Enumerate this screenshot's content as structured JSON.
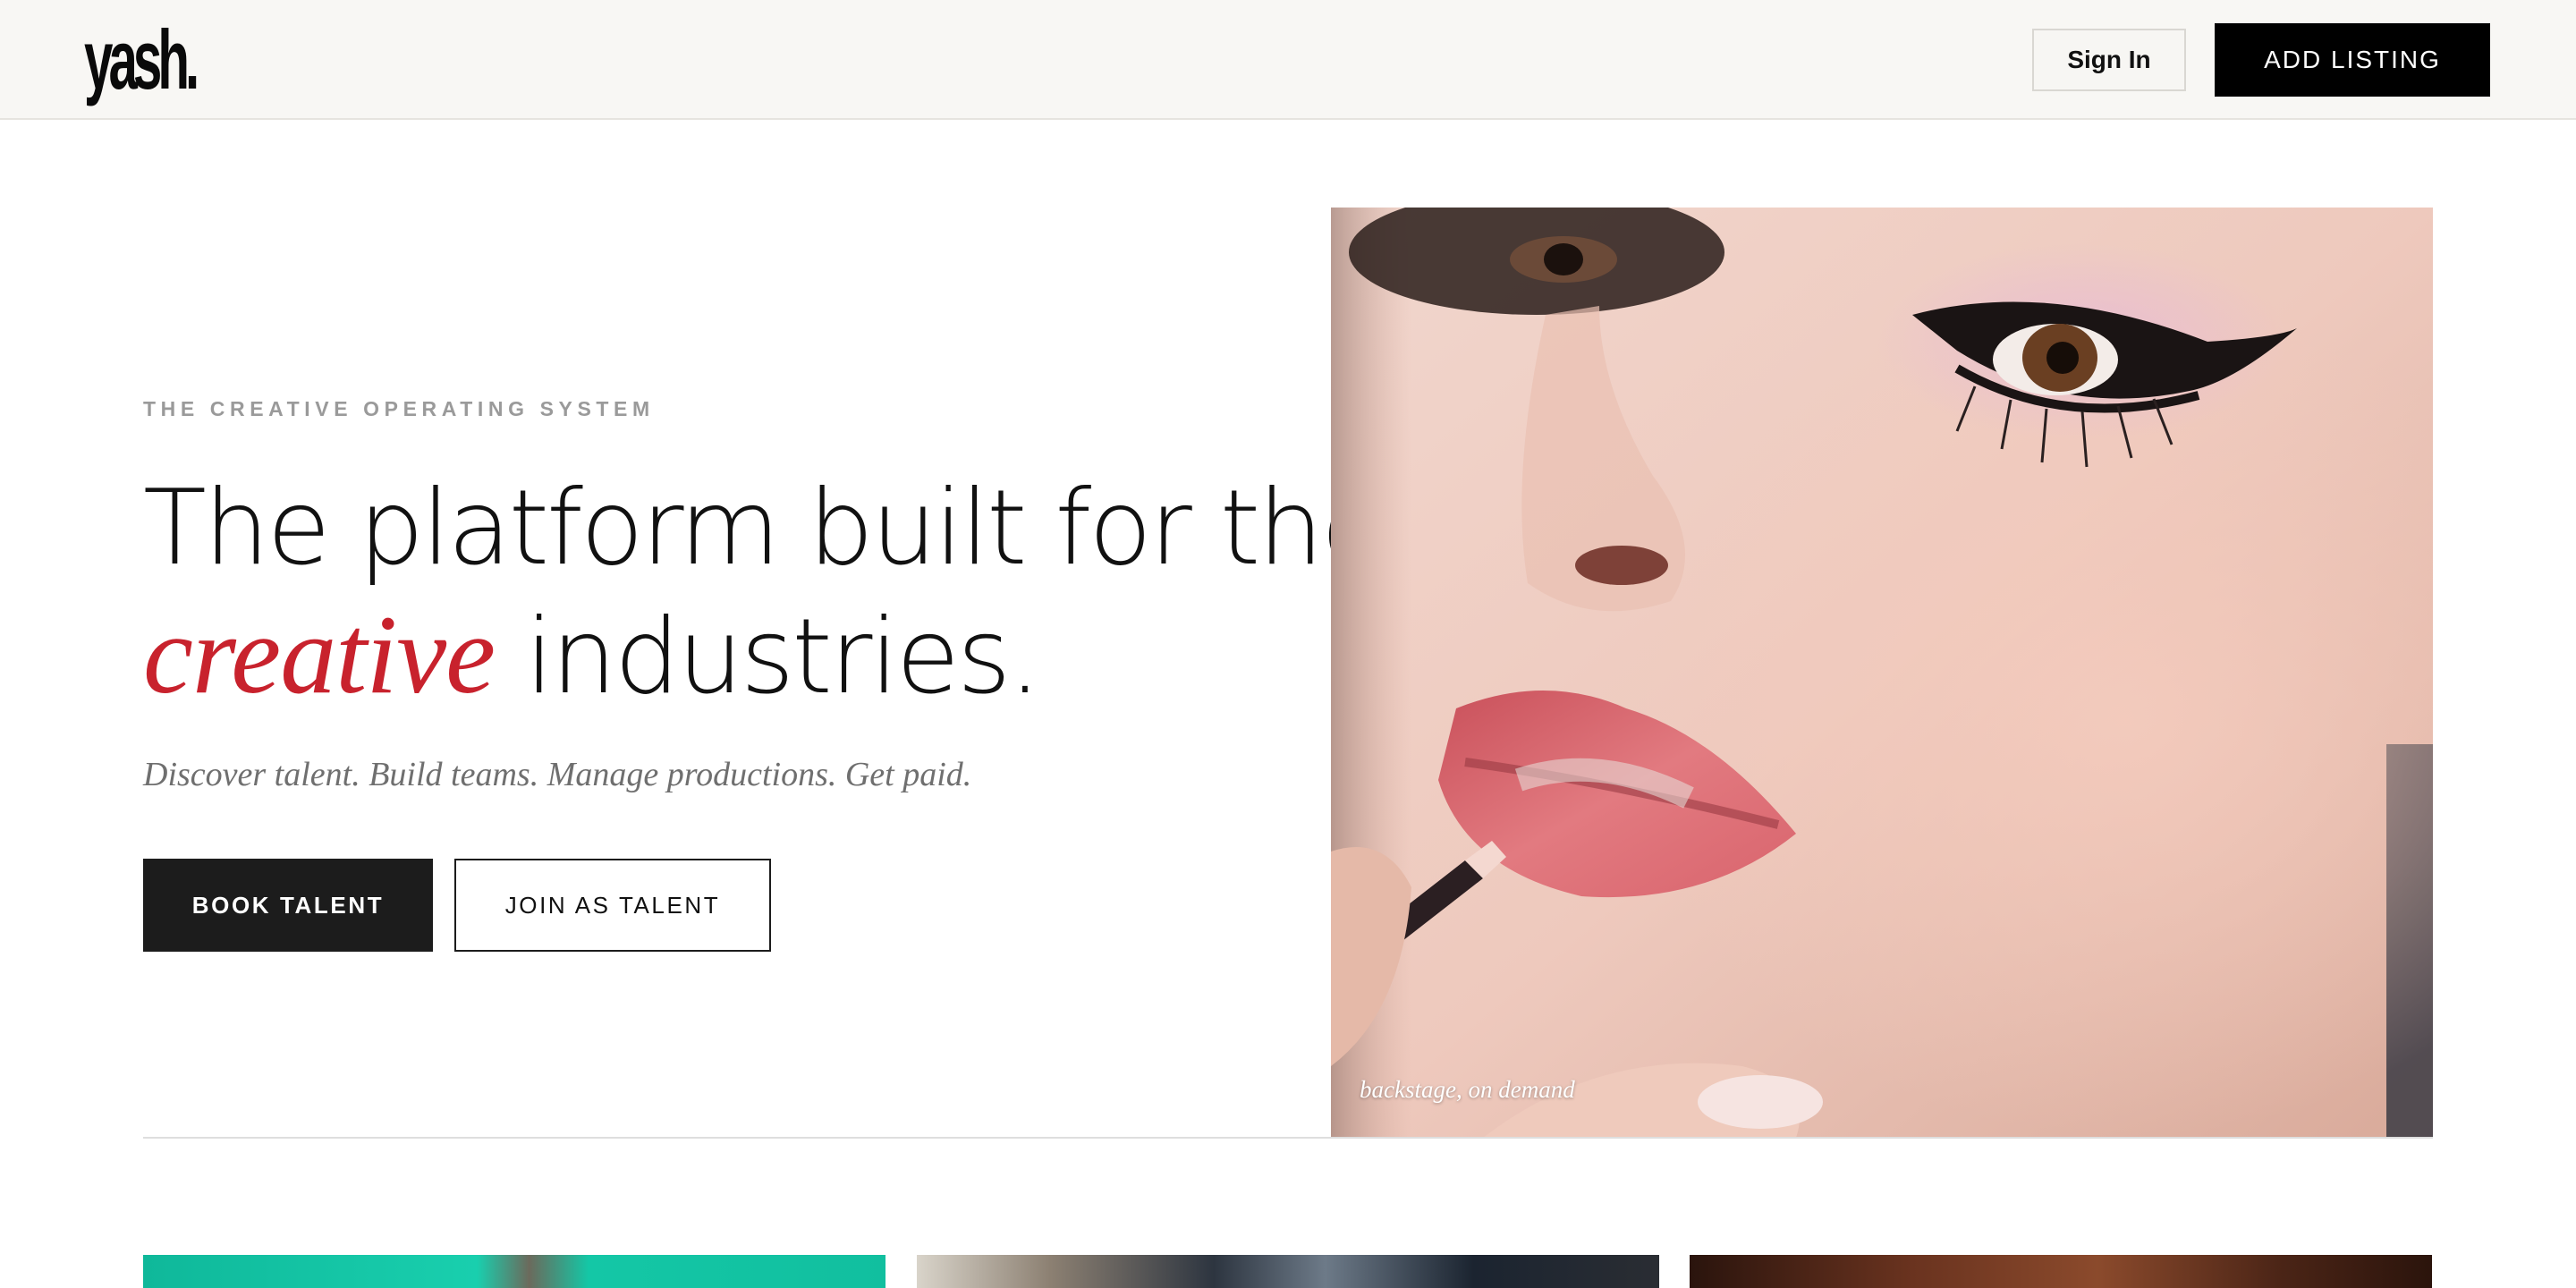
{
  "header": {
    "logo_text": "yash.",
    "sign_in_label": "Sign In",
    "add_listing_label": "ADD LISTING"
  },
  "hero": {
    "eyebrow": "THE CREATIVE OPERATING SYSTEM",
    "headline_line1": "The platform built for the",
    "headline_accent": "creative",
    "headline_rest": " industries.",
    "tagline": "Discover talent. Build teams. Manage productions. Get paid.",
    "book_talent_label": "BOOK TALENT",
    "join_talent_label": "JOIN AS TALENT",
    "image_caption": "backstage, on demand",
    "accent_color": "#c8222d"
  }
}
